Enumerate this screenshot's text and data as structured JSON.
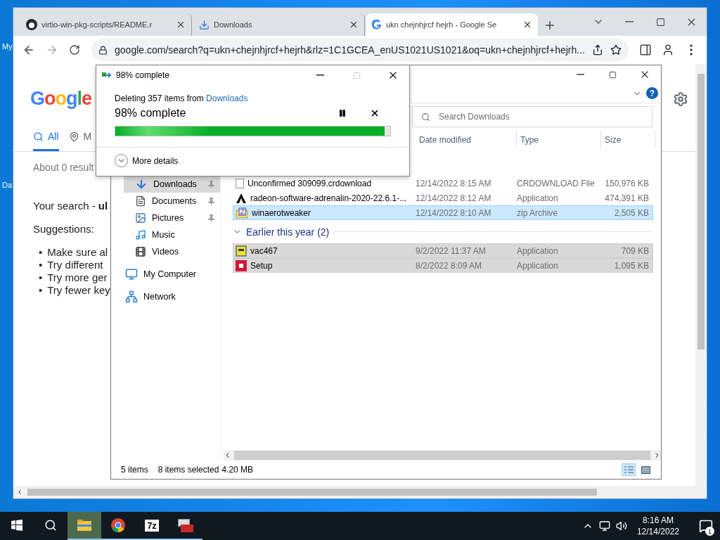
{
  "desktop": {
    "icon_labels": [
      "My",
      "Da"
    ]
  },
  "browser": {
    "tabs": [
      {
        "title": "virtio-win-pkg-scripts/README.r",
        "selected": false,
        "kind": "github"
      },
      {
        "title": "Downloads",
        "selected": false,
        "kind": "download"
      },
      {
        "title": "ukn chejnhjrcf hejrh - Google Se",
        "selected": true,
        "kind": "google"
      }
    ],
    "url": "google.com/search?q=ukn+chejnhjrcf+hejrh&rlz=1C1GCEA_enUS1021US1021&oq=ukn+chejnhjrcf+hejrh...",
    "logo": "Google",
    "search_tabs": [
      {
        "label": "All",
        "selected": true,
        "kind": "search"
      },
      {
        "label": "M",
        "selected": false,
        "kind": "map"
      }
    ],
    "result_stats": "About 0 result",
    "no_results": "Your search - **ul**",
    "suggestions_title": "Suggestions:",
    "suggestions": [
      {
        "bullet": "•",
        "text": "Make sure al"
      },
      {
        "bullet": "•",
        "text": "Try different"
      },
      {
        "bullet": "•",
        "text": "Try more ger"
      },
      {
        "bullet": "•",
        "text": "Try fewer key"
      }
    ]
  },
  "explorer": {
    "help": "?",
    "search": {
      "placeholder": "Search Downloads"
    },
    "columns": [
      "Date modified",
      "Type",
      "Size"
    ],
    "nav": [
      {
        "label": "Downloads",
        "selected": true,
        "pinned": true,
        "kind": "downloads"
      },
      {
        "label": "Documents",
        "selected": false,
        "pinned": true,
        "kind": "documents"
      },
      {
        "label": "Pictures",
        "selected": false,
        "pinned": true,
        "kind": "pictures"
      },
      {
        "label": "Music",
        "selected": false,
        "pinned": false,
        "kind": "music"
      },
      {
        "label": "Videos",
        "selected": false,
        "pinned": false,
        "kind": "videos"
      },
      {
        "label": "My Computer",
        "selected": false,
        "pinned": false,
        "kind": "computer"
      },
      {
        "label": "Network",
        "selected": false,
        "pinned": false,
        "kind": "network"
      }
    ],
    "list": [
      {
        "kind": "file",
        "name": "Unconfirmed 309099.crdownload",
        "date": "12/14/2022 8:15 AM",
        "type": "CRDOWNLOAD File",
        "size": "150,976 KB",
        "selected": false
      },
      {
        "kind": "file",
        "name": "radeon-software-adrenalin-2020-22.6.1-...",
        "date": "12/14/2022 8:12 AM",
        "type": "Application",
        "size": "474,391 KB",
        "selected": false
      },
      {
        "kind": "file",
        "name": "winaerotweaker",
        "date": "12/14/2022 8:10 AM",
        "type": "zip Archive",
        "size": "2,505 KB",
        "selected": true,
        "focused": true
      },
      {
        "kind": "group",
        "title": "Earlier this year (2)",
        "expanded": true
      },
      {
        "kind": "file",
        "name": "vac467",
        "date": "9/2/2022 11:37 AM",
        "type": "Application",
        "size": "709 KB",
        "selected": true,
        "focused": false
      },
      {
        "kind": "file",
        "name": "Setup",
        "date": "8/2/2022 8:09 AM",
        "type": "Application",
        "size": "1,095 KB",
        "selected": true,
        "focused": false
      }
    ],
    "status": {
      "count": "5 items",
      "selection": "8 items selected",
      "size": "4.20 MB"
    }
  },
  "dialog": {
    "title": "98% complete",
    "message": "Deleting 357 items from ",
    "source": "Downloads",
    "progress_label": "98% complete",
    "level": 0.98,
    "details": "More details"
  },
  "taskbar": {
    "apps": [
      {
        "kind": "explorer",
        "active": true,
        "running": true
      },
      {
        "kind": "chrome",
        "active": false,
        "running": true
      },
      {
        "kind": "archiver",
        "label": "7z",
        "active": false,
        "running": true
      },
      {
        "kind": "toolbox",
        "active": false,
        "running": true
      }
    ],
    "time": "8:16 AM",
    "date": "12/14/2022",
    "notifications": "1"
  }
}
